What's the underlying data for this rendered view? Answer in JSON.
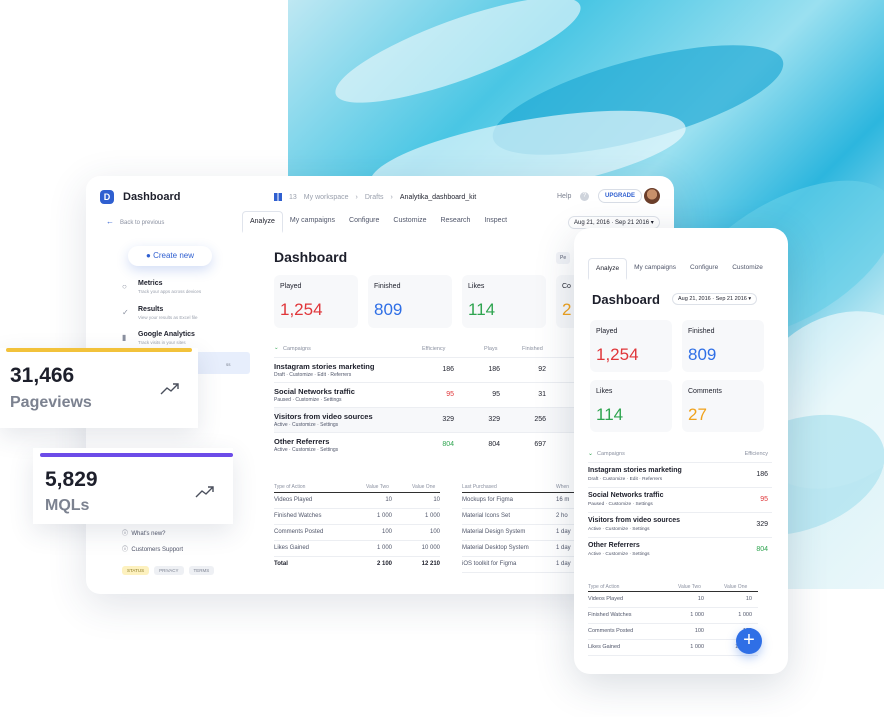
{
  "desktop": {
    "app_title": "Dashboard",
    "logo": "D",
    "breadcrumb": {
      "count": "13",
      "workspace": "My workspace",
      "drafts": "Drafts",
      "current": "Analytika_dashboard_kit"
    },
    "help": "Help",
    "help_icon": "?",
    "upgrade": "UPGRADE",
    "back": "Back to previous",
    "tabs": [
      "Analyze",
      "My campaigns",
      "Configure",
      "Customize",
      "Research",
      "Inspect"
    ],
    "date_range": "Aug 21, 2016 · Sep 21 2016",
    "create_new": "Create new",
    "nav": [
      {
        "title": "Metrics",
        "subtitle": "Track your apps across devices"
      },
      {
        "title": "Results",
        "subtitle": "View your results as Excel file"
      },
      {
        "title": "Google Analytics",
        "subtitle": "Track visits in your sites"
      }
    ],
    "nav_ss": "ss",
    "footer_links": [
      "What's new?",
      "Customers Support"
    ],
    "footer_pills": [
      "STATUS",
      "PRIVACY",
      "TERMS"
    ],
    "page_title": "Dashboard",
    "period_btn": "Pe",
    "cards": [
      {
        "label": "Played",
        "value": "1,254",
        "color": "#e0363a"
      },
      {
        "label": "Finished",
        "value": "809",
        "color": "#2f6fe6"
      },
      {
        "label": "Likes",
        "value": "114",
        "color": "#2ea44f"
      },
      {
        "label": "Co",
        "value": "2",
        "color": "#f0a21c"
      }
    ],
    "campaigns_header": {
      "name": "Campaigns",
      "efficiency": "Efficiency",
      "plays": "Plays",
      "finished": "Finished"
    },
    "campaigns": [
      {
        "name": "Instagram stories marketing",
        "status": "Draft · Customize · Edit · Referrers",
        "efficiency": "186",
        "plays": "186",
        "finished": "92"
      },
      {
        "name": "Social Networks traffic",
        "status": "Paused · Customize · Settings",
        "efficiency": "95",
        "plays": "95",
        "finished": "31"
      },
      {
        "name": "Visitors from video sources",
        "status": "Active · Customize · Settings",
        "efficiency": "329",
        "plays": "329",
        "finished": "256"
      },
      {
        "name": "Other Referrers",
        "status": "Active · Customize · Settings",
        "efficiency": "804",
        "plays": "804",
        "finished": "697"
      }
    ],
    "actions_table": {
      "headers": [
        "Type of Action",
        "Value Two",
        "Value One"
      ],
      "rows": [
        [
          "Videos Played",
          "10",
          "10"
        ],
        [
          "Finished Watches",
          "1 000",
          "1 000"
        ],
        [
          "Comments Posted",
          "100",
          "100"
        ],
        [
          "Likes Gained",
          "1 000",
          "10 000"
        ],
        [
          "Total",
          "2 100",
          "12 210"
        ]
      ]
    },
    "purchases_table": {
      "headers": [
        "Last Purchased",
        "When"
      ],
      "rows": [
        [
          "Mockups for Figma",
          "16 m"
        ],
        [
          "Material Icons Set",
          "2 ho"
        ],
        [
          "Material Design System",
          "1 day"
        ],
        [
          "Material Desktop System",
          "1 day"
        ],
        [
          "iOS toolkit for Figma",
          "1 day"
        ]
      ]
    }
  },
  "stats": [
    {
      "value": "31,466",
      "label": "Pageviews",
      "accent": "#f2c23b"
    },
    {
      "value": "5,829",
      "label": "MQLs",
      "accent": "#6c4ce8"
    }
  ],
  "mobile": {
    "tabs": [
      "Analyze",
      "My campaigns",
      "Configure",
      "Customize"
    ],
    "title": "Dashboard",
    "date_range": "Aug 21, 2016 · Sep 21 2016",
    "cards": [
      {
        "label": "Played",
        "value": "1,254",
        "color": "#e0363a"
      },
      {
        "label": "Finished",
        "value": "809",
        "color": "#2f6fe6"
      },
      {
        "label": "Likes",
        "value": "114",
        "color": "#2ea44f"
      },
      {
        "label": "Comments",
        "value": "27",
        "color": "#f0a21c"
      }
    ],
    "campaigns_header": {
      "name": "Campaigns",
      "efficiency": "Efficiency"
    },
    "campaigns": [
      {
        "name": "Instagram stories marketing",
        "status": "Draft · Customize · Edit · Referrers",
        "efficiency": "186"
      },
      {
        "name": "Social Networks traffic",
        "status": "Paused · Customize · Settings",
        "efficiency": "95"
      },
      {
        "name": "Visitors from video sources",
        "status": "Active · Customize · Settings",
        "efficiency": "329"
      },
      {
        "name": "Other Referrers",
        "status": "Active · Customize · Settings",
        "efficiency": "804"
      }
    ],
    "table": {
      "headers": [
        "Type of Action",
        "Value Two",
        "Value One"
      ],
      "rows": [
        [
          "Videos Played",
          "10",
          "10"
        ],
        [
          "Finished Watches",
          "1 000",
          "1 000"
        ],
        [
          "Comments Posted",
          "100",
          "100"
        ],
        [
          "Likes Gained",
          "1 000",
          "10 000"
        ]
      ]
    },
    "fab_symbol": "+"
  },
  "icons": {
    "create": "plus-circle-icon",
    "back": "arrow-left-icon",
    "trend": "trending-up-icon",
    "campaigns_sort": "chevron-sort-icon"
  }
}
